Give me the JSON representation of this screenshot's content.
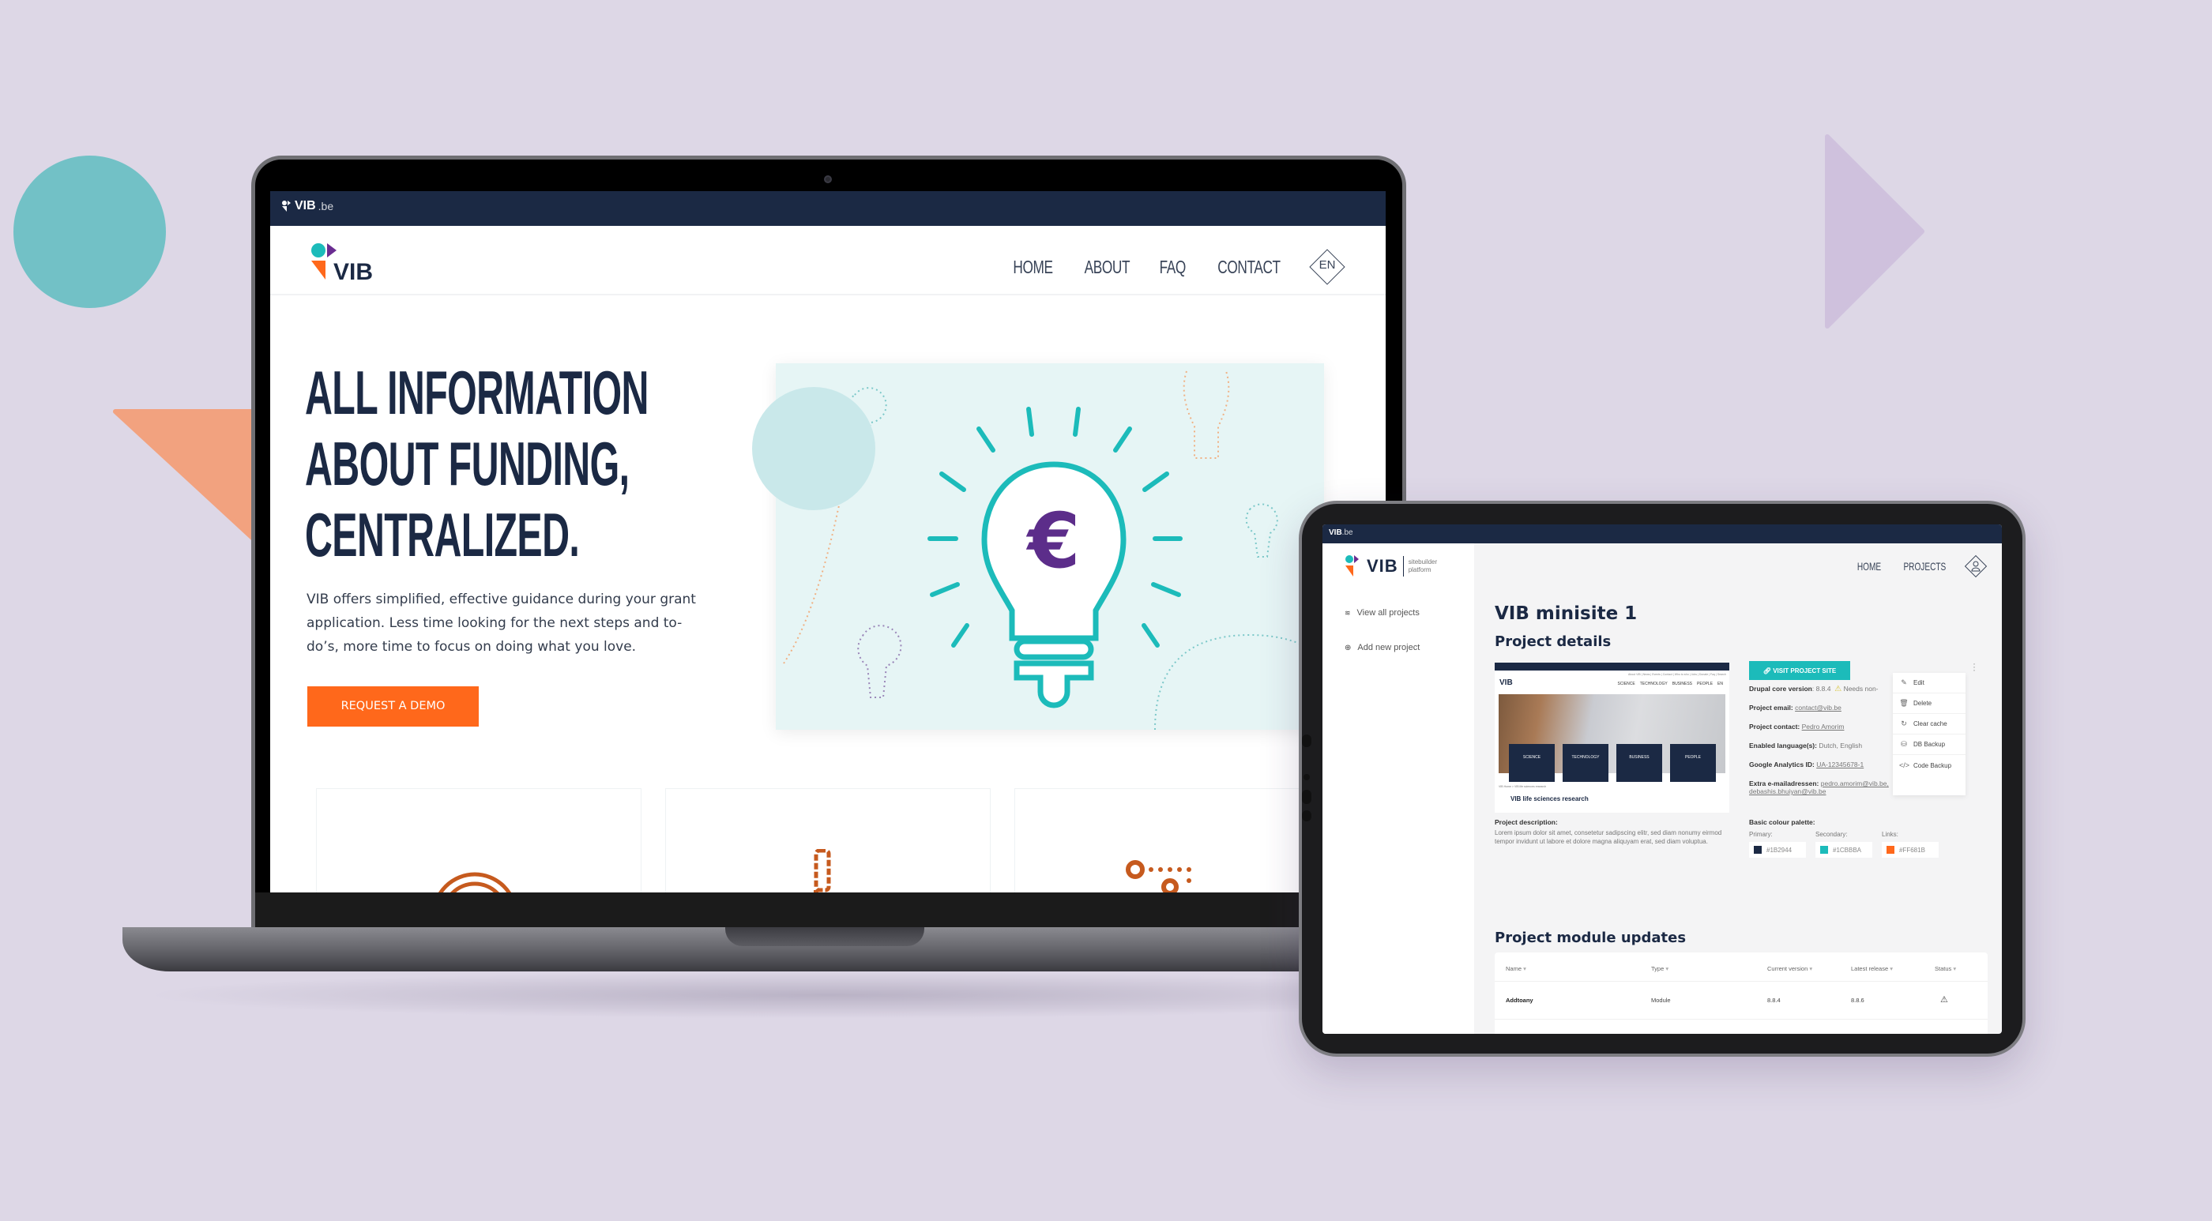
{
  "background": {
    "color": "#ddd7e6",
    "decor_colors": {
      "teal_circle": "#72c1c6",
      "orange_triangle": "#f2a27f",
      "purple_triangle": "#cfc1dd"
    }
  },
  "laptop": {
    "topbar": {
      "logo_text": "VIB",
      "logo_suffix": ".be"
    },
    "header": {
      "logo_text": "VIB",
      "nav": [
        {
          "label": "HOME"
        },
        {
          "label": "ABOUT"
        },
        {
          "label": "FAQ"
        },
        {
          "label": "CONTACT"
        }
      ],
      "language": "EN"
    },
    "hero": {
      "title_lines": [
        "ALL INFORMATION",
        "ABOUT FUNDING,",
        "CENTRALIZED."
      ],
      "copy": "VIB offers simplified, effective guidance during your grant application. Less time looking for the next steps and to-do’s, more time to focus on doing what you love.",
      "cta_label": "REQUEST A DEMO",
      "illustration_symbol": "€"
    },
    "feature_cards": [
      {
        "icon": "coin-stack-icon"
      },
      {
        "icon": "microscope-icon"
      },
      {
        "icon": "network-dots-icon"
      }
    ]
  },
  "tablet": {
    "topbar": {
      "logo_text": "VIB",
      "logo_suffix": ".be"
    },
    "sidebar": {
      "logo_text": "VIB",
      "logo_subtitle_1": "sitebuilder",
      "logo_subtitle_2": "platform",
      "items": [
        {
          "label": "View all projects",
          "icon": "layers-icon"
        },
        {
          "label": "Add new project",
          "icon": "add-stack-icon"
        }
      ]
    },
    "nav": [
      {
        "label": "HOME"
      },
      {
        "label": "PROJECTS"
      }
    ],
    "page_title": "VIB minisite 1",
    "section_details": "Project details",
    "preview": {
      "top_links": "About VIB | News | Events | Contact | Who is who | Jobs | Donate | Faq | Search",
      "logo_text": "VIB",
      "nav": [
        "SCIENCE",
        "TECHNOLOGY",
        "BUSINESS",
        "PEOPLE"
      ],
      "lang": "EN",
      "tiles": [
        "SCIENCE",
        "TECHNOLOGY",
        "BUSINESS",
        "PEOPLE"
      ],
      "breadcrumb": "VIB Home  >  VIB life sciences research",
      "title": "VIB life sciences research"
    },
    "description_label": "Project description:",
    "description": "Lorem ipsum dolor sit amet, consetetur sadipscing elitr, sed diam nonumy eirmod tempor invidunt ut labore et dolore magna aliquyam erat, sed diam voluptua.",
    "visit_button": "VISIT PROJECT SITE",
    "fields": {
      "drupal_label": "Drupal core version",
      "drupal_value": ": 8.8.4",
      "drupal_warning": "Needs non-",
      "email_label": "Project email:",
      "email_value": "contact@vib.be",
      "contact_label": "Project contact:",
      "contact_value": "Pedro Amorim",
      "languages_label": "Enabled language(s):",
      "languages_value": "Dutch, English",
      "ga_label": "Google Analytics ID:",
      "ga_value": "UA-12345678-1",
      "extra_label": "Extra e-mailadressen:",
      "extra_value_1": "pedro.amorim@vib.be,",
      "extra_value_2": "debashis.bhuiyan@vib.be"
    },
    "actions_menu": [
      {
        "label": "Edit",
        "icon": "pencil-icon"
      },
      {
        "label": "Delete",
        "icon": "trash-icon"
      },
      {
        "label": "Clear cache",
        "icon": "refresh-icon"
      },
      {
        "label": "DB Backup",
        "icon": "database-icon"
      },
      {
        "label": "Code Backup",
        "icon": "code-icon"
      }
    ],
    "palette": {
      "label": "Basic colour palette:",
      "items": [
        {
          "name": "Primary:",
          "hex": "#1B2944"
        },
        {
          "name": "Secondary:",
          "hex": "#1CBBBA"
        },
        {
          "name": "Links:",
          "hex": "#FF681B"
        }
      ]
    },
    "section_modules": "Project module updates",
    "table": {
      "columns": [
        "Name",
        "Type",
        "Current version",
        "Latest release",
        "Status"
      ],
      "rows": [
        {
          "name": "Addtoany",
          "type": "Module",
          "current": "8.8.4",
          "latest": "8.8.6",
          "status": "warning"
        }
      ]
    }
  }
}
